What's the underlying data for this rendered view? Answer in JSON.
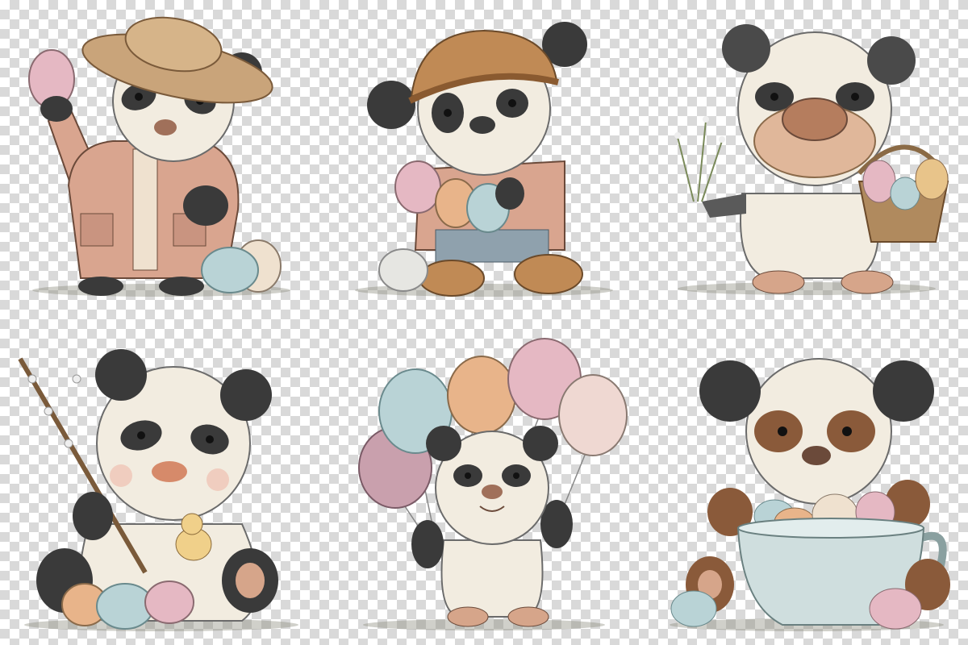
{
  "palette": {
    "fur_white": "#f2ece0",
    "fur_black": "#3a3a3a",
    "nose_brown": "#a0705a",
    "coat_pink": "#d9a58f",
    "hat_tan": "#c9a47a",
    "egg_pink": "#e5b8c3",
    "egg_blue": "#b9d3d6",
    "egg_peach": "#e8b48a",
    "egg_cream": "#efe1cf",
    "basket": "#b08a5e",
    "cup": "#cfdede",
    "ground": "#8a8a7a"
  },
  "illustrations": [
    {
      "subject": "panda",
      "accessories": [
        "straw-hat",
        "pink-coat"
      ],
      "holding": "pink-egg",
      "eggs": [
        "blue",
        "cream"
      ]
    },
    {
      "subject": "panda",
      "accessories": [
        "knit-hat",
        "pink-jacket",
        "boots"
      ],
      "holding": "eggs",
      "eggs": [
        "pink",
        "peach",
        "blue",
        "white"
      ]
    },
    {
      "subject": "bear",
      "accessories": [
        "basket"
      ],
      "holding": "flowers",
      "eggs": [
        "pink",
        "blue",
        "peach"
      ]
    },
    {
      "subject": "panda",
      "accessories": [
        "willow-branch",
        "chick"
      ],
      "holding": "branch",
      "eggs": [
        "peach",
        "blue",
        "pink"
      ]
    },
    {
      "subject": "panda",
      "accessories": [
        "balloons"
      ],
      "holding": "balloon-strings",
      "eggs": []
    },
    {
      "subject": "panda",
      "accessories": [
        "teacup"
      ],
      "holding": "cup-rim",
      "eggs": [
        "blue",
        "peach",
        "cream",
        "pink"
      ]
    }
  ]
}
